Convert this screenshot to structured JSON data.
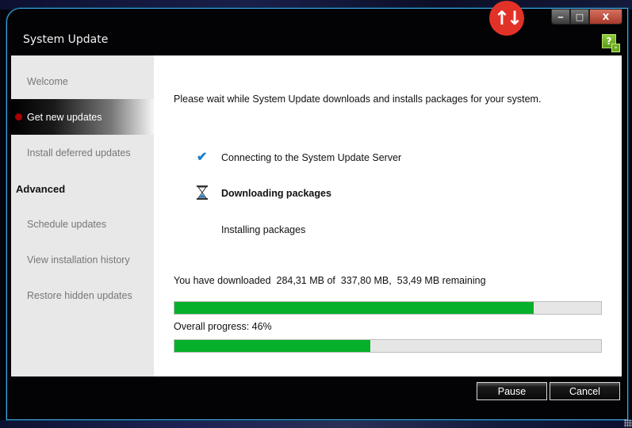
{
  "window": {
    "title": "System Update",
    "controls": {
      "minimize": "‒",
      "maximize": "□",
      "close": "X"
    },
    "app_icon": "↑↓",
    "help_icon": "?",
    "help_sub_icon": "»"
  },
  "sidebar": {
    "items": [
      {
        "label": "Welcome",
        "active": false
      },
      {
        "label": "Get new updates",
        "active": true
      },
      {
        "label": "Install deferred updates",
        "active": false
      }
    ],
    "advanced_header": "Advanced",
    "advanced_items": [
      {
        "label": "Schedule updates"
      },
      {
        "label": "View installation history"
      },
      {
        "label": "Restore hidden updates"
      }
    ]
  },
  "main": {
    "intro": "Please wait while System Update downloads and installs packages for your system.",
    "steps": [
      {
        "label": "Connecting to the System Update Server",
        "status": "done",
        "icon": "✔"
      },
      {
        "label": "Downloading packages",
        "status": "in-progress"
      },
      {
        "label": "Installing packages",
        "status": "pending"
      }
    ],
    "download_text": "You have downloaded  284,31 MB of  337,80 MB,  53,49 MB remaining",
    "download_progress": 0.8417,
    "overall_label": "Overall progress: 46%",
    "overall_progress": 0.46,
    "progress_color": "#06b02a"
  },
  "buttons": {
    "pause": "Pause",
    "cancel": "Cancel"
  }
}
